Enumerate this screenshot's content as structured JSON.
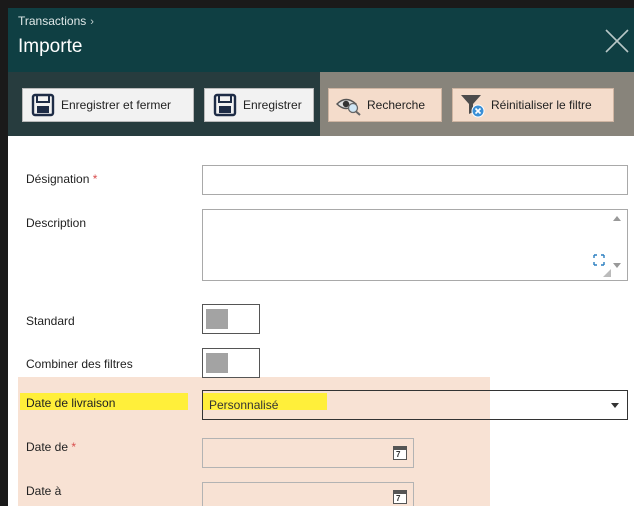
{
  "header": {
    "breadcrumb": "Transactions",
    "breadcrumb_separator": "›",
    "title": "Importe"
  },
  "toolbar": {
    "save_close_label": "Enregistrer et fermer",
    "save_label": "Enregistrer",
    "search_label": "Recherche",
    "reset_filter_label": "Réinitialiser le filtre"
  },
  "form": {
    "designation": {
      "label": "Désignation",
      "required_mark": "*",
      "value": ""
    },
    "description": {
      "label": "Description",
      "value": ""
    },
    "standard": {
      "label": "Standard"
    },
    "combine_filters": {
      "label": "Combiner des filtres"
    },
    "delivery_date": {
      "label": "Date de livraison",
      "value": "Personnalisé"
    },
    "date_from": {
      "label": "Date de",
      "required_mark": "*",
      "value": "",
      "calendar_digit": "7"
    },
    "date_to": {
      "label": "Date à",
      "value": "",
      "calendar_digit": "7"
    }
  },
  "colors": {
    "header_bg": "#0f3f43",
    "toolbar_bg": "#273c3e",
    "highlight_yellow": "#ffef3a",
    "highlight_peach": "#f8e2d4",
    "required_red": "#d84d4d"
  }
}
